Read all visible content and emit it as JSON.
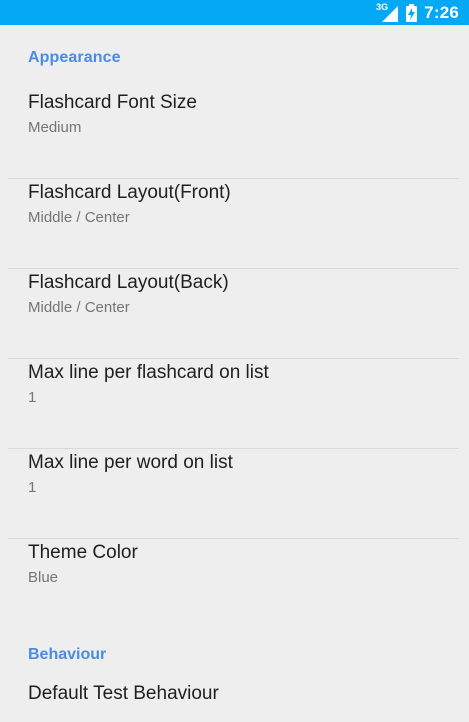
{
  "status_bar": {
    "network_type": "3G",
    "time": "7:26",
    "colors": {
      "background": "#03a9f4",
      "foreground": "#ffffff"
    }
  },
  "sections": {
    "appearance": {
      "header": "Appearance",
      "items": [
        {
          "title": "Flashcard Font Size",
          "summary": "Medium"
        },
        {
          "title": "Flashcard Layout(Front)",
          "summary": "Middle / Center"
        },
        {
          "title": "Flashcard Layout(Back)",
          "summary": "Middle / Center"
        },
        {
          "title": "Max line per flashcard on list",
          "summary": "1"
        },
        {
          "title": "Max line per word on list",
          "summary": "1"
        },
        {
          "title": "Theme Color",
          "summary": "Blue"
        }
      ]
    },
    "behaviour": {
      "header": "Behaviour",
      "items": [
        {
          "title": "Default Test Behaviour"
        }
      ]
    }
  },
  "colors": {
    "page_background": "#eeeeee",
    "category_header": "#4a8be8",
    "title_text": "#1f1f1f",
    "summary_text": "#757575",
    "divider": "#d9d9d9"
  }
}
